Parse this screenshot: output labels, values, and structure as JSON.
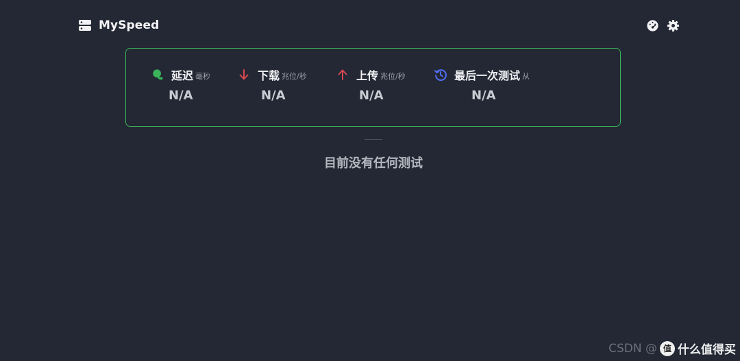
{
  "app": {
    "title": "MySpeed",
    "logo_icon": "server-icon"
  },
  "header": {
    "actions": [
      {
        "icon": "speed-test-icon",
        "label": "run-speedtest"
      },
      {
        "icon": "gear-icon",
        "label": "settings"
      }
    ]
  },
  "stats": {
    "border_color": "#3ab35a",
    "ping": {
      "label": "延迟",
      "unit": "毫秒",
      "value": "N/A",
      "icon": "ping-pong-icon",
      "color": "#3ab35a"
    },
    "download": {
      "label": "下载",
      "unit": "兆位/秒",
      "value": "N/A",
      "icon": "arrow-down-icon",
      "color": "#d9484f"
    },
    "upload": {
      "label": "上传",
      "unit": "兆位/秒",
      "value": "N/A",
      "icon": "arrow-up-icon",
      "color": "#d9484f"
    },
    "last_test": {
      "label": "最后一次测试",
      "unit": "从",
      "value": "N/A",
      "icon": "history-icon",
      "color": "#4f6ef2"
    }
  },
  "empty_state": {
    "message": "目前没有任何测试"
  },
  "watermark": {
    "csdn": "CSDN @",
    "badge": "值",
    "text": "什么值得买"
  }
}
